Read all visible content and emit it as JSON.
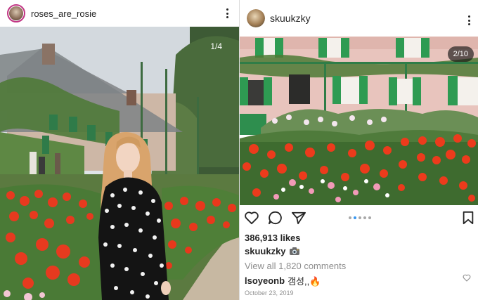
{
  "left_post": {
    "username": "roses_are_rosie",
    "photo_counter": "1/4"
  },
  "right_post": {
    "username": "skuukzky",
    "photo_counter": "2/10",
    "carousel": {
      "dot_count": 5,
      "active_index": 1
    },
    "likes": "386,913 likes",
    "caption_user": "skuukzky",
    "caption_icon": "camera-emoji",
    "view_comments": "View all 1,820 comments",
    "comment": {
      "user": "lsoyeonb",
      "text": "갬성,,🔥"
    },
    "date": "October 23, 2019"
  },
  "icons": {
    "like": "heart-icon",
    "comment": "comment-icon",
    "share": "send-icon",
    "save": "bookmark-icon",
    "more": "more-options-icon"
  },
  "colors": {
    "text": "#262626",
    "muted": "#8e8e8e",
    "carousel_active": "#3897f0",
    "story_ring": "#c13584"
  }
}
